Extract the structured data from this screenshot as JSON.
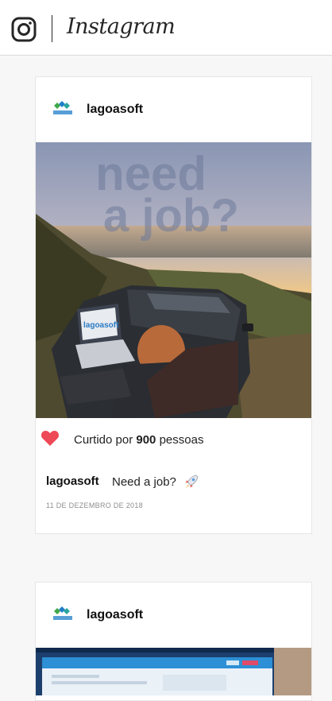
{
  "header": {
    "brand": "Instagram",
    "icons": [
      "instagram-camera-icon"
    ]
  },
  "posts": [
    {
      "username": "lagoasoft",
      "avatar_icon": "lagoasoft-logo",
      "image": {
        "headline_line1": "need",
        "headline_line2": "a job?",
        "laptop_brand": "lagoasoft"
      },
      "likes_prefix": "Curtido por",
      "likes_count": "900",
      "likes_suffix": "pessoas",
      "caption_user": "lagoasoft",
      "caption_text": "Need a job?",
      "caption_emoji_icon": "rocket-icon",
      "date": "11 DE DEZEMBRO DE 2018",
      "colors": {
        "heart": "#ed4956"
      }
    },
    {
      "username": "lagoasoft",
      "avatar_icon": "lagoasoft-logo"
    }
  ]
}
